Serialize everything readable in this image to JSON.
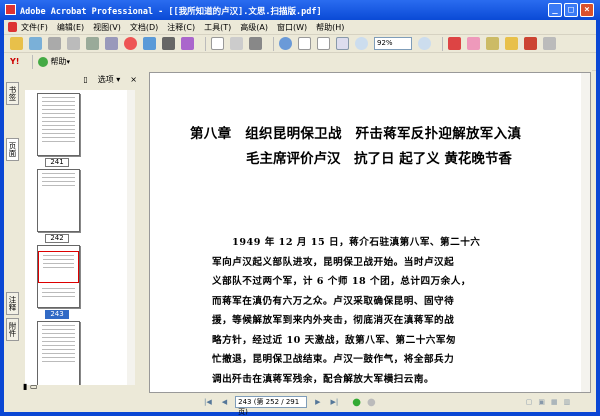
{
  "window": {
    "title": "Adobe Acrobat Professional - [[我所知道的卢汉].文思.扫描版.pdf]"
  },
  "menu": [
    "文件(F)",
    "编辑(E)",
    "视图(V)",
    "文档(D)",
    "注释(C)",
    "工具(T)",
    "高级(A)",
    "窗口(W)",
    "帮助(H)"
  ],
  "toolbar": {
    "zoom_value": "92%",
    "help_label": "帮助"
  },
  "side_tabs": [
    "书签",
    "页面",
    "注释",
    "附件"
  ],
  "panel": {
    "options_label": "选项",
    "close": "×"
  },
  "thumbnails": [
    {
      "label": "241"
    },
    {
      "label": "242"
    },
    {
      "label": "243",
      "selected": true
    }
  ],
  "document": {
    "title_line1": "第八章　组织昆明保卫战　歼击蒋军反扑迎解放军入滇",
    "title_line2": "毛主席评价卢汉　抗了日 起了义 黄花晚节香",
    "paragraph_lines": [
      "　　1949 年 12 月 15 日，蒋介石驻滇第八军、第二十六",
      "军向卢汉起义部队进攻，昆明保卫战开始。当时卢汉起",
      "义部队不过两个军，计 6 个师 18 个团，总计四万余人，",
      "而蒋军在滇仍有六万之众。卢汉采取确保昆明、固守待",
      "援，等候解放军到来内外夹击，彻底消灭在滇蒋军的战",
      "略方针，经过近 10 天激战，敌第八军、第二十六军匆",
      "忙撤退，昆明保卫战结束。卢汉一鼓作气，将全部兵力",
      "调出歼击在滇蒋军残余，配合解放大军横扫云南。"
    ]
  },
  "navigation": {
    "page_display": "243 (第 252 / 291 页)"
  }
}
